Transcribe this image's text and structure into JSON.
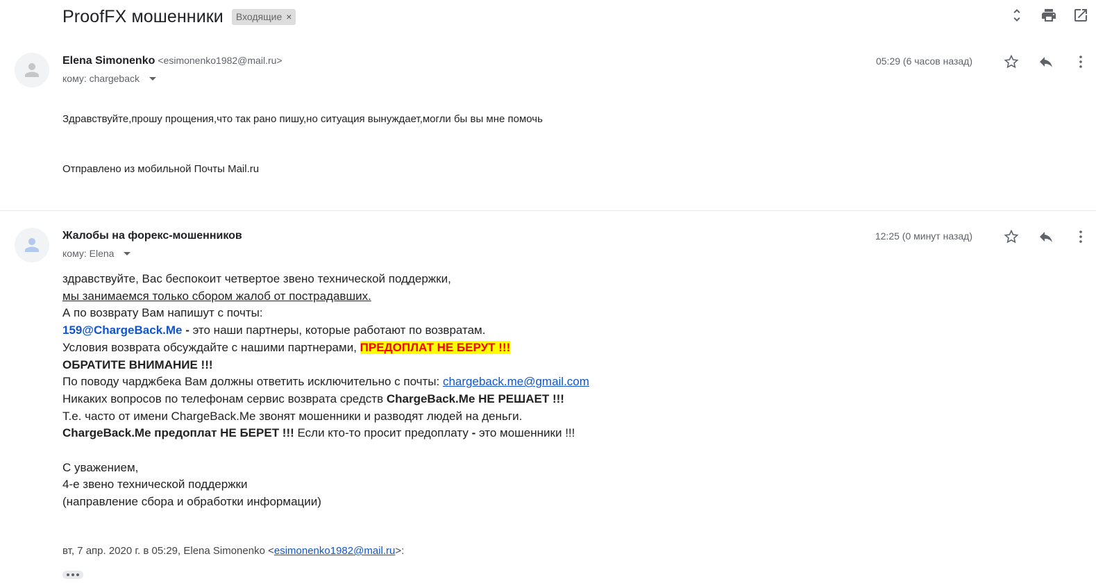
{
  "thread": {
    "subject": "ProofFX мошенники",
    "label": "Входящие",
    "label_close": "×"
  },
  "icons": {
    "expand": "unfold-icon",
    "print": "print-icon",
    "open_new_window": "open-in-new-icon",
    "star": "star-icon",
    "reply": "reply-icon",
    "more": "more-vert-icon",
    "avatar": "person-icon"
  },
  "messages": [
    {
      "sender_name": "Elena Simonenko",
      "sender_email": "<esimonenko1982@mail.ru>",
      "to": "кому: chargeback",
      "time": "05:29 (6 часов назад)",
      "body": [
        "Здравствуйте,прошу прощения,что так рано пишу,но ситуация вынуждает,могли бы вы мне помочь",
        "Отправлено из мобильной Почты Mail.ru"
      ]
    },
    {
      "sender_name": "Жалобы на форекс-мошенников",
      "to": "кому: Elena",
      "time": "12:25 (0 минут назад)",
      "body": {
        "line1": "здравствуйте, Вас беспокоит четвертое звено технической поддержки,",
        "line2": "мы занимаемся только сбором жалоб от пострадавших.",
        "line3": "А по возврату Вам напишут с почты:",
        "line4_email": "159@ChargeBack.Me",
        "line4_dash": " - ",
        "line4_rest": "это наши партнеры, которые работают по возвратам.",
        "line5_text": "Условия возврата обсуждайте с нашими партнерами, ",
        "line5_highlight": "ПРЕДОПЛАТ НЕ БЕРУТ !!!",
        "line6": "ОБРАТИТЕ ВНИМАНИЕ !!!",
        "line7_text": "По поводу чарджбека Вам должны ответить исключительно с почты: ",
        "line7_link": "chargeback.me@gmail.com",
        "line8_text": "Никаких вопросов по телефонам сервис возврата средств ",
        "line8_bold": "ChargeBack.Me НЕ РЕШАЕТ !!!",
        "line9": "Т.е. часто от имени ChargeBack.Me звонят мошенники и разводят людей на деньги.",
        "line10_bold": "ChargeBack.Me предоплат НЕ БЕРЕТ !!!",
        "line10_text": " Если кто-то просит предоплату ",
        "line10_dash": "-",
        "line10_rest": " это мошенники !!!",
        "sign1": "С уважением,",
        "sign2": "4-е звено технической поддержки",
        "sign3": "(направление сбора и обработки информации)",
        "quote_prefix": "вт, 7 апр. 2020 г. в 05:29, Elena Simonenko <",
        "quote_email": "esimonenko1982@mail.ru",
        "quote_suffix": ">:"
      }
    }
  ]
}
